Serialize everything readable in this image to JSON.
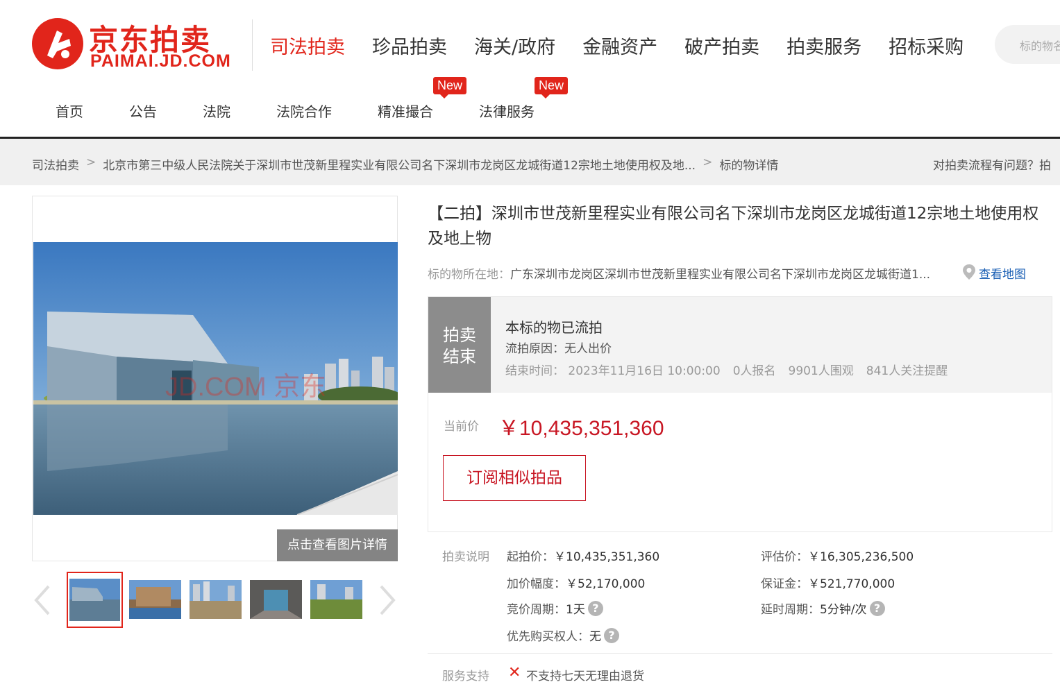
{
  "brand": {
    "cn": "京东拍卖",
    "en": "PAIMAI.JD.COM",
    "color": "#e1251b"
  },
  "topnav": [
    "司法拍卖",
    "珍品拍卖",
    "海关/政府",
    "金融资产",
    "破产拍卖",
    "拍卖服务",
    "招标采购"
  ],
  "search": {
    "placeholder": "标的物名称"
  },
  "subnav": [
    {
      "label": "首页",
      "badge": ""
    },
    {
      "label": "公告",
      "badge": ""
    },
    {
      "label": "法院",
      "badge": ""
    },
    {
      "label": "法院合作",
      "badge": ""
    },
    {
      "label": "精准撮合",
      "badge": "New"
    },
    {
      "label": "法律服务",
      "badge": "New"
    }
  ],
  "breadcrumb": {
    "items": [
      "司法拍卖",
      "北京市第三中级人民法院关于深圳市世茂新里程实业有限公司名下深圳市龙岗区龙城街道12宗地土地使用权及地...",
      "标的物详情"
    ],
    "help": "对拍卖流程有问题？拍"
  },
  "gallery": {
    "watermark": "JD.COM 京东",
    "detail_button": "点击查看图片详情",
    "thumbnails": [
      "museum-building",
      "construction-site",
      "empty-land",
      "interior-space",
      "grassland"
    ]
  },
  "item": {
    "title": "【二拍】深圳市世茂新里程实业有限公司名下深圳市龙岗区龙城街道12宗地土地使用权及地上物",
    "location_label": "标的物所在地：",
    "location": "广东深圳市龙岗区深圳市世茂新里程实业有限公司名下深圳市龙岗区龙城街道1...",
    "map_link": "查看地图"
  },
  "status": {
    "tag": "拍卖结束",
    "tag_line1": "拍卖",
    "tag_line2": "结束",
    "headline": "本标的物已流拍",
    "reason": "流拍原因：无人出价",
    "end_time": "结束时间： 2023年11月16日 10:00:00",
    "signups": "0人报名",
    "views": "9901人围观",
    "followers": "841人关注提醒"
  },
  "price": {
    "label": "当前价",
    "value": "￥10,435,351,360",
    "subscribe_button": "订阅相似拍品"
  },
  "rules": {
    "label": "拍卖说明",
    "start_price_label": "起拍价：",
    "start_price": "￥10,435,351,360",
    "appraisal_label": "评估价：",
    "appraisal": "￥16,305,236,500",
    "increment_label": "加价幅度：",
    "increment": "￥52,170,000",
    "deposit_label": "保证金：",
    "deposit": "￥521,770,000",
    "cycle_label": "竞价周期：",
    "cycle": "1天",
    "delay_label": "延时周期：",
    "delay": "5分钟/次",
    "priority_label": "优先购买权人：",
    "priority": "无"
  },
  "service": {
    "label": "服务支持",
    "text": "不支持七天无理由退货"
  }
}
